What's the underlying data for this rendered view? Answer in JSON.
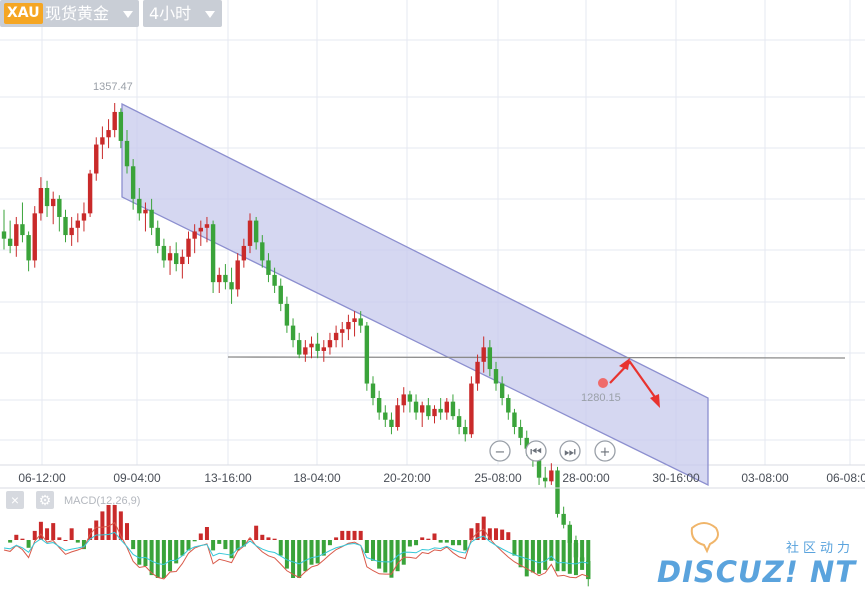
{
  "toolbar": {
    "symbol_code": "XAU",
    "symbol_name": "现货黄金",
    "timeframe": "4小时"
  },
  "navigation": [
    "zoom-out",
    "step-back",
    "step-forward",
    "zoom-in"
  ],
  "macd_label": "MACD(12,26,9)",
  "watermark": {
    "top": "社区动力",
    "brand": "DISCUZ! NT"
  },
  "colors": {
    "up": "#c92a2a",
    "down": "#3aa33a",
    "channel": "#8c8fcf",
    "macd_line": "#d95a4a",
    "signal_line": "#36c8d8"
  },
  "chart_data": {
    "type": "candlestick",
    "x_ticks": [
      "06-12:00",
      "09-04:00",
      "13-16:00",
      "18-04:00",
      "20-20:00",
      "25-08:00",
      "28-00:00",
      "30-16:00",
      "03-08:00",
      "06-08:00"
    ],
    "annotations": {
      "high": "1357.47",
      "low": "1280.15"
    },
    "ohlc": [
      [
        1322,
        1328,
        1317,
        1320
      ],
      [
        1320,
        1325,
        1316,
        1318
      ],
      [
        1318,
        1326,
        1315,
        1324
      ],
      [
        1324,
        1330,
        1319,
        1321
      ],
      [
        1321,
        1322,
        1311,
        1314
      ],
      [
        1314,
        1329,
        1312,
        1327
      ],
      [
        1327,
        1337,
        1325,
        1334
      ],
      [
        1334,
        1336,
        1326,
        1329
      ],
      [
        1329,
        1333,
        1324,
        1331
      ],
      [
        1331,
        1332,
        1322,
        1326
      ],
      [
        1326,
        1328,
        1319,
        1321
      ],
      [
        1321,
        1326,
        1318,
        1323
      ],
      [
        1323,
        1327,
        1319,
        1325
      ],
      [
        1325,
        1330,
        1322,
        1327
      ],
      [
        1327,
        1339,
        1326,
        1338
      ],
      [
        1338,
        1348,
        1336,
        1346
      ],
      [
        1346,
        1351,
        1342,
        1348
      ],
      [
        1348,
        1353,
        1345,
        1350
      ],
      [
        1350,
        1357.47,
        1348,
        1355
      ],
      [
        1355,
        1356,
        1345,
        1347
      ],
      [
        1347,
        1350,
        1338,
        1340
      ],
      [
        1340,
        1342,
        1328,
        1331
      ],
      [
        1331,
        1334,
        1325,
        1327
      ],
      [
        1327,
        1330,
        1322,
        1328
      ],
      [
        1328,
        1331,
        1321,
        1323
      ],
      [
        1323,
        1325,
        1316,
        1318
      ],
      [
        1318,
        1320,
        1312,
        1314
      ],
      [
        1314,
        1318,
        1310,
        1316
      ],
      [
        1316,
        1319,
        1311,
        1313
      ],
      [
        1313,
        1317,
        1309,
        1315
      ],
      [
        1315,
        1322,
        1313,
        1320
      ],
      [
        1320,
        1324,
        1316,
        1322
      ],
      [
        1322,
        1325,
        1318,
        1323
      ],
      [
        1323,
        1326,
        1319,
        1324
      ],
      [
        1324,
        1325,
        1305,
        1308
      ],
      [
        1308,
        1312,
        1305,
        1310
      ],
      [
        1310,
        1313,
        1306,
        1308
      ],
      [
        1308,
        1312,
        1302,
        1306
      ],
      [
        1306,
        1316,
        1304,
        1314
      ],
      [
        1314,
        1320,
        1312,
        1318
      ],
      [
        1318,
        1327,
        1316,
        1325
      ],
      [
        1325,
        1326,
        1317,
        1319
      ],
      [
        1319,
        1321,
        1312,
        1314
      ],
      [
        1314,
        1316,
        1308,
        1310
      ],
      [
        1310,
        1312,
        1305,
        1307
      ],
      [
        1307,
        1309,
        1300,
        1302
      ],
      [
        1302,
        1304,
        1294,
        1296
      ],
      [
        1296,
        1298,
        1290,
        1292
      ],
      [
        1292,
        1294,
        1287,
        1288
      ],
      [
        1288,
        1292,
        1286,
        1290
      ],
      [
        1290,
        1293,
        1287,
        1291
      ],
      [
        1291,
        1294,
        1287,
        1289
      ],
      [
        1289,
        1292,
        1286,
        1290
      ],
      [
        1290,
        1294,
        1288,
        1292
      ],
      [
        1292,
        1296,
        1290,
        1294
      ],
      [
        1294,
        1297,
        1290,
        1295
      ],
      [
        1295,
        1299,
        1292,
        1297
      ],
      [
        1297,
        1300,
        1293,
        1298
      ],
      [
        1298,
        1300,
        1294,
        1296
      ],
      [
        1296,
        1297,
        1278,
        1280
      ],
      [
        1280,
        1282,
        1274,
        1276
      ],
      [
        1276,
        1278,
        1270,
        1272
      ],
      [
        1272,
        1274,
        1268,
        1270
      ],
      [
        1270,
        1272,
        1266,
        1268
      ],
      [
        1268,
        1276,
        1267,
        1274
      ],
      [
        1274,
        1279,
        1272,
        1277
      ],
      [
        1277,
        1278,
        1272,
        1275
      ],
      [
        1275,
        1277,
        1270,
        1272
      ],
      [
        1272,
        1275,
        1268,
        1274
      ],
      [
        1274,
        1276,
        1270,
        1271
      ],
      [
        1271,
        1274,
        1269,
        1273
      ],
      [
        1273,
        1276,
        1270,
        1272
      ],
      [
        1272,
        1276,
        1270,
        1275
      ],
      [
        1275,
        1277,
        1270,
        1271
      ],
      [
        1271,
        1273,
        1266,
        1268
      ],
      [
        1268,
        1270,
        1264,
        1266
      ],
      [
        1266,
        1282,
        1265,
        1280
      ],
      [
        1280,
        1288,
        1278,
        1286
      ],
      [
        1286,
        1293,
        1283,
        1290
      ],
      [
        1290,
        1292,
        1282,
        1284
      ],
      [
        1284,
        1286,
        1278,
        1280
      ],
      [
        1280,
        1282,
        1274,
        1276
      ],
      [
        1276,
        1277,
        1270,
        1272
      ],
      [
        1272,
        1273,
        1266,
        1268
      ],
      [
        1268,
        1270,
        1263,
        1265
      ],
      [
        1265,
        1267,
        1260,
        1262
      ],
      [
        1262,
        1264,
        1257,
        1259
      ],
      [
        1259,
        1261,
        1252,
        1254
      ],
      [
        1254,
        1257,
        1251,
        1253
      ],
      [
        1253,
        1258,
        1252,
        1256
      ],
      [
        1256,
        1257,
        1243,
        1244
      ],
      [
        1244,
        1246,
        1240,
        1241
      ],
      [
        1241,
        1242,
        1234,
        1236
      ],
      [
        1236,
        1238,
        1231,
        1232
      ],
      [
        1232,
        1234,
        1229,
        1231
      ],
      [
        1231,
        1232,
        1224,
        1226
      ]
    ]
  }
}
